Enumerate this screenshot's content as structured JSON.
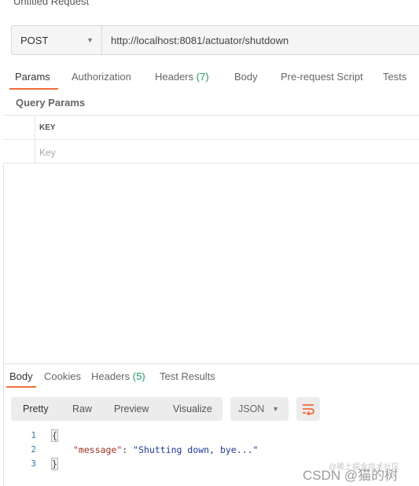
{
  "request": {
    "title": "Untitled Request",
    "method": "POST",
    "url": "http://localhost:8081/actuator/shutdown"
  },
  "request_tabs": {
    "params": "Params",
    "authorization": "Authorization",
    "headers": "Headers",
    "headers_count": "(7)",
    "body": "Body",
    "prerequest": "Pre-request Script",
    "tests": "Tests"
  },
  "query_params": {
    "label": "Query Params",
    "key_header": "KEY",
    "key_placeholder": "Key"
  },
  "response_tabs": {
    "body": "Body",
    "cookies": "Cookies",
    "headers": "Headers",
    "headers_count": "(5)",
    "test_results": "Test Results"
  },
  "response_format": {
    "pretty": "Pretty",
    "raw": "Raw",
    "preview": "Preview",
    "visualize": "Visualize",
    "language": "JSON"
  },
  "response_body": {
    "line_numbers": [
      "1",
      "2",
      "3"
    ],
    "open_brace": "{",
    "key": "\"message\"",
    "colon": ": ",
    "value": "\"Shutting down, bye...\"",
    "close_brace": "}"
  },
  "watermark": {
    "small": "@稀土掘金技术社区",
    "main": "CSDN @猫的树"
  },
  "colors": {
    "accent": "#f26b3a",
    "count_green": "#20a060",
    "json_key": "#a3321f",
    "json_string": "#1a38a6"
  },
  "icons": [
    "chevron-down-icon",
    "wrap-lines-icon"
  ]
}
